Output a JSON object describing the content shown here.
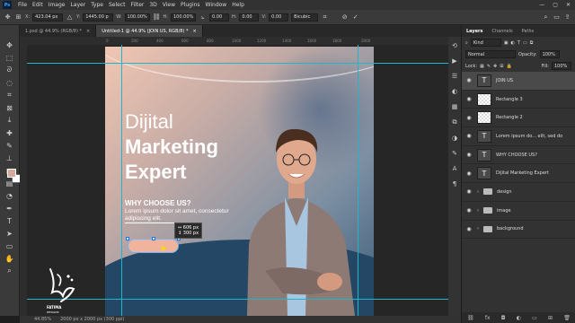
{
  "menu": {
    "logo": "Ps",
    "items": [
      "File",
      "Edit",
      "Image",
      "Layer",
      "Type",
      "Select",
      "Filter",
      "3D",
      "View",
      "Plugins",
      "Window",
      "Help"
    ]
  },
  "options": {
    "x_label": "X:",
    "x_value": "423.04 px",
    "y_label": "Y:",
    "y_value": "1445.00 p",
    "w_label": "W:",
    "w_value": "100.00%",
    "h_label": "H:",
    "h_value": "100.00%",
    "angle_value": "0.00",
    "h_skew_label": "H:",
    "h_skew_value": "0.00",
    "v_skew_label": "V:",
    "v_skew_value": "0.00",
    "interp": "Bicubic"
  },
  "tabs": [
    {
      "label": "1.psd @ 44.9% (RGB/8) *",
      "close": "×"
    },
    {
      "label": "Untitled-1 @ 44.9% (JOIN US, RGB/8) *",
      "close": "×"
    }
  ],
  "ruler_ticks": [
    "0",
    "200",
    "400",
    "600",
    "800",
    "1000",
    "1200",
    "1400",
    "1600",
    "1800",
    "2000"
  ],
  "design": {
    "headline_1": "Dijital",
    "headline_2": "Marketing",
    "headline_3": "Expert",
    "why": "WHY CHOOSE US?",
    "lorem": "Lorem ipsum dolor sit amet, consectetur adipiscing elit.",
    "tip_w": "↔ 606 px",
    "tip_h": "↕ 300 px"
  },
  "status": {
    "zoom": "44.85%",
    "size": "2000 px x 2000 px (300 ppi)"
  },
  "panel": {
    "tabs": [
      "Layers",
      "Channels",
      "Paths"
    ],
    "filter": "Kind",
    "blend": "Normal",
    "opacity_label": "Opacity:",
    "opacity": "100%",
    "lock_label": "Lock:",
    "fill_label": "Fill:",
    "fill": "100%",
    "layers": [
      {
        "name": "JOIN US",
        "kind": "text"
      },
      {
        "name": "Rectangle 3",
        "kind": "raster"
      },
      {
        "name": "Rectangle 2",
        "kind": "raster"
      },
      {
        "name": "Lorem ipsum do... elit, sed do",
        "kind": "text"
      },
      {
        "name": "WHY CHOOSE US?",
        "kind": "text"
      },
      {
        "name": "Dijital Marketing Expert",
        "kind": "text"
      },
      {
        "name": "design",
        "kind": "folder"
      },
      {
        "name": "image",
        "kind": "folder"
      },
      {
        "name": "background",
        "kind": "folder"
      }
    ]
  },
  "watermark": {
    "title": "FATIMA",
    "subtitle": "DESIGNS"
  },
  "colors": {
    "accent": "#1473e6",
    "guide": "#21b5c9",
    "fg_swatch": "#d8a89a",
    "pill": "#f0b49d"
  }
}
